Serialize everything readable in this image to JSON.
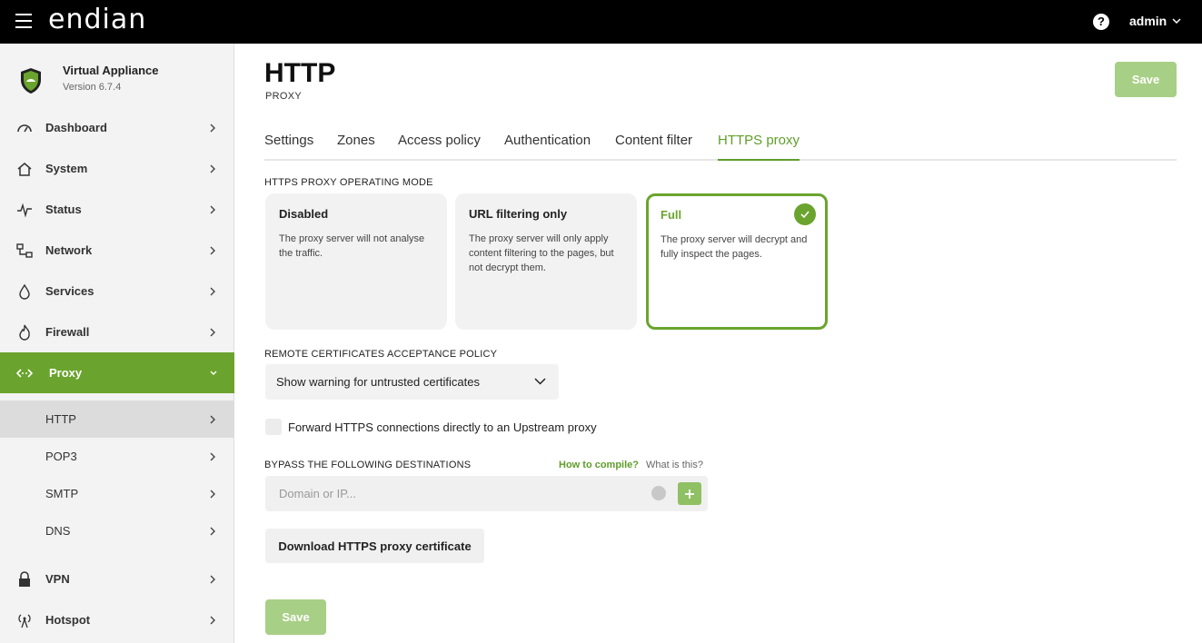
{
  "topbar": {
    "logo": "endian",
    "help": "?",
    "user": "admin"
  },
  "sidebar": {
    "appliance_name": "Virtual Appliance",
    "appliance_version": "Version 6.7.4",
    "items": [
      {
        "label": "Dashboard",
        "icon": "gauge-icon"
      },
      {
        "label": "System",
        "icon": "home-icon"
      },
      {
        "label": "Status",
        "icon": "pulse-icon"
      },
      {
        "label": "Network",
        "icon": "network-icon"
      },
      {
        "label": "Services",
        "icon": "drop-icon"
      },
      {
        "label": "Firewall",
        "icon": "flame-icon"
      },
      {
        "label": "Proxy",
        "icon": "proxy-icon"
      },
      {
        "label": "VPN",
        "icon": "lock-icon"
      },
      {
        "label": "Hotspot",
        "icon": "antenna-icon"
      }
    ],
    "subitems": [
      {
        "label": "HTTP"
      },
      {
        "label": "POP3"
      },
      {
        "label": "SMTP"
      },
      {
        "label": "DNS"
      }
    ]
  },
  "page": {
    "title": "HTTP",
    "subtitle": "PROXY",
    "save_label": "Save"
  },
  "tabs": [
    "Settings",
    "Zones",
    "Access policy",
    "Authentication",
    "Content filter",
    "HTTPS proxy"
  ],
  "operating_mode": {
    "label": "HTTPS PROXY OPERATING MODE",
    "options": [
      {
        "title": "Disabled",
        "description": "The proxy server will not analyse the traffic."
      },
      {
        "title": "URL filtering only",
        "description": "The proxy server will only apply content filtering to the pages, but not decrypt them."
      },
      {
        "title": "Full",
        "description": "The proxy server will decrypt and fully inspect the pages."
      }
    ],
    "selected": "Full"
  },
  "certificates_policy": {
    "label": "REMOTE CERTIFICATES ACCEPTANCE POLICY",
    "value": "Show warning for untrusted certificates"
  },
  "forward_upstream": {
    "label": "Forward HTTPS connections directly to an Upstream proxy",
    "checked": false
  },
  "bypass": {
    "label": "BYPASS THE FOLLOWING DESTINATIONS",
    "how_to": "How to compile?",
    "what_is": "What is this?",
    "placeholder": "Domain or IP..."
  },
  "download_label": "Download HTTPS proxy certificate",
  "bottom_save_label": "Save",
  "colors": {
    "accent": "#6aa42e",
    "save_disabled": "#a8cf86"
  }
}
